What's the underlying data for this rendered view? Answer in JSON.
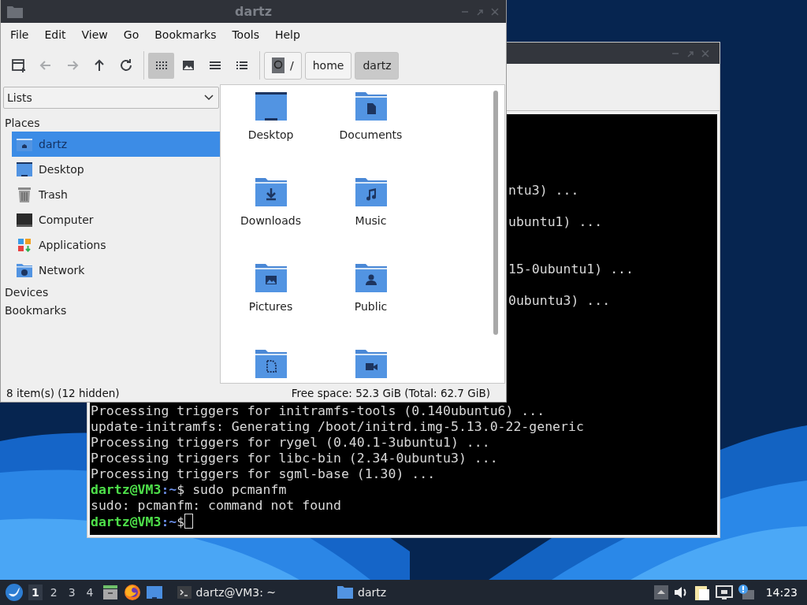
{
  "file_manager": {
    "title": "dartz",
    "menu": [
      "File",
      "Edit",
      "View",
      "Go",
      "Bookmarks",
      "Tools",
      "Help"
    ],
    "toolbar": {
      "nav": [
        {
          "kind": "new-tab",
          "disabled": false
        },
        {
          "kind": "back",
          "disabled": true
        },
        {
          "kind": "forward",
          "disabled": true
        },
        {
          "kind": "up",
          "disabled": false
        },
        {
          "kind": "reload",
          "disabled": false
        }
      ],
      "views": [
        {
          "kind": "icons",
          "selected": true
        },
        {
          "kind": "thumbnails",
          "selected": false
        },
        {
          "kind": "compact",
          "selected": false
        },
        {
          "kind": "details",
          "selected": false
        }
      ],
      "path": [
        {
          "label": "/",
          "kind": "root",
          "selected": false
        },
        {
          "label": "home",
          "kind": "dir",
          "selected": false
        },
        {
          "label": "dartz",
          "kind": "dir",
          "selected": true
        }
      ]
    },
    "side_pane": {
      "mode": "Lists",
      "places_header": "Places",
      "places": [
        {
          "label": "dartz",
          "kind": "home",
          "selected": true
        },
        {
          "label": "Desktop",
          "kind": "desktop",
          "selected": false
        },
        {
          "label": "Trash",
          "kind": "trash",
          "selected": false
        },
        {
          "label": "Computer",
          "kind": "computer",
          "selected": false
        },
        {
          "label": "Applications",
          "kind": "applications",
          "selected": false
        },
        {
          "label": "Network",
          "kind": "network",
          "selected": false
        }
      ],
      "devices_header": "Devices",
      "bookmarks_header": "Bookmarks"
    },
    "files": [
      {
        "name": "Desktop",
        "kind": "desktop"
      },
      {
        "name": "Documents",
        "kind": "document"
      },
      {
        "name": "Downloads",
        "kind": "download"
      },
      {
        "name": "Music",
        "kind": "music"
      },
      {
        "name": "Pictures",
        "kind": "pictures"
      },
      {
        "name": "Public",
        "kind": "public"
      },
      {
        "kind": "template"
      },
      {
        "kind": "video"
      }
    ],
    "status": {
      "items": "8 item(s) (12 hidden)",
      "free_space": "Free space: 52.3 GiB (Total: 62.7 GiB)"
    }
  },
  "terminal": {
    "fragments": [
      "ntu3) ...",
      "ubuntu1) ...",
      "15-0ubuntu1) ...",
      "0ubuntu3) ..."
    ],
    "lines": [
      {
        "kind": "output",
        "text": "Processing triggers for initramfs-tools (0.140ubuntu6) ..."
      },
      {
        "kind": "output",
        "text": "update-initramfs: Generating /boot/initrd.img-5.13.0-22-generic"
      },
      {
        "kind": "output",
        "text": "Processing triggers for rygel (0.40.1-3ubuntu1) ..."
      },
      {
        "kind": "output",
        "text": "Processing triggers for libc-bin (2.34-0ubuntu3) ..."
      },
      {
        "kind": "output",
        "text": "Processing triggers for sgml-base (1.30) ..."
      },
      {
        "kind": "prompt",
        "user": "dartz@VM3",
        "path": ":~",
        "command": "$ sudo pcmanfm",
        "cursor": false
      },
      {
        "kind": "output",
        "text": "sudo: pcmanfm: command not found"
      },
      {
        "kind": "prompt",
        "user": "dartz@VM3",
        "path": ":~",
        "command": "$",
        "cursor": true
      }
    ]
  },
  "taskbar": {
    "workspaces": [
      {
        "label": "1",
        "selected": true
      },
      {
        "label": "2",
        "selected": false
      },
      {
        "label": "3",
        "selected": false
      },
      {
        "label": "4",
        "selected": false
      }
    ],
    "tasks": [
      {
        "label": "dartz@VM3: ~",
        "kind": "terminal"
      },
      {
        "label": "dartz",
        "kind": "folder"
      }
    ],
    "clock": "14:23"
  }
}
